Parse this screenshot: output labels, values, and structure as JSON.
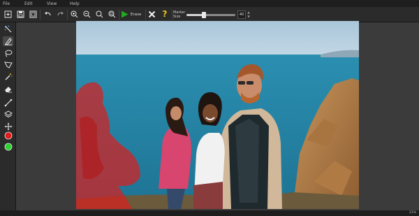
{
  "menu": {
    "file": "File",
    "edit": "Edit",
    "view": "View",
    "help": "Help"
  },
  "toolbar": {
    "erase_label": "Erase",
    "marker_label_line1": "Marker",
    "marker_label_line2": "Size",
    "marker_size": "40",
    "marker_size_fraction": 0.35,
    "help_symbol": "?"
  },
  "status": {
    "zoom": "21%"
  },
  "colors": {
    "accent_green": "#1faa1f",
    "help_yellow": "#f2c21b",
    "mask_red": "#d81f1f",
    "marker_color_red": "#e21b1b",
    "marker_color_green": "#2fd12f"
  },
  "icons": {
    "toolbar": [
      "new-icon",
      "save-icon",
      "save-as-icon",
      "undo-icon",
      "redo-icon",
      "zoom-in-icon",
      "zoom-out-icon",
      "zoom-actual-icon",
      "zoom-fit-icon",
      "play-icon",
      "cancel-icon",
      "help-icon"
    ],
    "sidebar": [
      "auto-select-icon",
      "marker-icon",
      "lasso-icon",
      "polygon-icon",
      "magic-wand-icon",
      "eraser-icon",
      "line-icon",
      "layers-icon",
      "move-icon",
      "color-red-icon",
      "color-green-icon"
    ]
  }
}
